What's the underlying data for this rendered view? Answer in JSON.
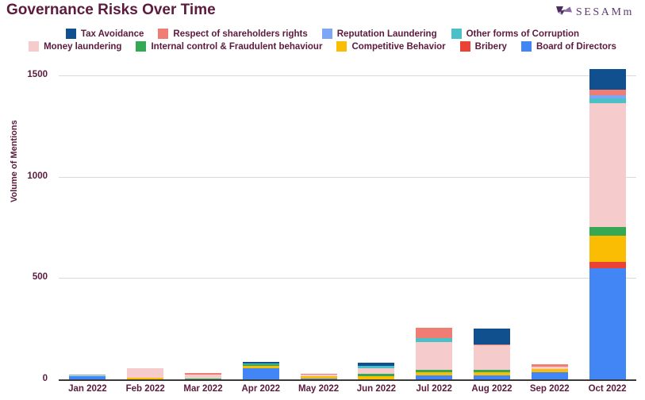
{
  "header": {
    "title": "Governance Risks Over Time",
    "logo_text": "SESAMm",
    "logo_mark_name": "sesamm-arrow-logo"
  },
  "chart_data": {
    "type": "bar",
    "stacked": true,
    "title": "Governance Risks Over Time",
    "xlabel": "",
    "ylabel": "Volume of Mentions",
    "ylim": [
      0,
      1500
    ],
    "yticks": [
      0,
      500,
      1000,
      1500
    ],
    "grid": true,
    "legend_position": "top",
    "categories": [
      "Jan 2022",
      "Feb 2022",
      "Mar 2022",
      "Apr 2022",
      "May 2022",
      "Jun 2022",
      "Jul 2022",
      "Aug 2022",
      "Sep 2022",
      "Oct 2022"
    ],
    "series": [
      {
        "name": "Board of Directors",
        "color": "#4285f4",
        "values": [
          14,
          0,
          0,
          56,
          3,
          0,
          20,
          20,
          36,
          550
        ]
      },
      {
        "name": "Bribery",
        "color": "#ea4335",
        "values": [
          0,
          0,
          0,
          0,
          0,
          0,
          0,
          0,
          0,
          28
        ]
      },
      {
        "name": "Competitive Behavior",
        "color": "#fbbc04",
        "values": [
          0,
          6,
          0,
          10,
          11,
          16,
          16,
          14,
          14,
          132
        ]
      },
      {
        "name": "Internal control & Fraudulent behaviour",
        "color": "#34a853",
        "values": [
          0,
          0,
          4,
          8,
          0,
          11,
          12,
          12,
          0,
          44
        ]
      },
      {
        "name": "Money laundering",
        "color": "#f5cbcb",
        "values": [
          4,
          48,
          20,
          0,
          10,
          28,
          137,
          122,
          14,
          610
        ]
      },
      {
        "name": "Other forms of Corruption",
        "color": "#4bc0c6",
        "values": [
          4,
          0,
          0,
          5,
          0,
          13,
          20,
          0,
          0,
          22
        ]
      },
      {
        "name": "Reputation Laundering",
        "color": "#7da6f7",
        "values": [
          0,
          0,
          0,
          0,
          0,
          0,
          0,
          0,
          0,
          18
        ]
      },
      {
        "name": "Respect of shareholders rights",
        "color": "#ef7d74",
        "values": [
          0,
          0,
          8,
          0,
          4,
          0,
          48,
          6,
          10,
          24
        ]
      },
      {
        "name": "Tax Avoidance",
        "color": "#11508f",
        "values": [
          0,
          0,
          0,
          7,
          0,
          14,
          0,
          78,
          0,
          105
        ]
      }
    ]
  },
  "legend": {
    "rows": [
      [
        {
          "label": "Tax Avoidance",
          "color": "#11508f"
        },
        {
          "label": "Respect of shareholders rights",
          "color": "#ef7d74"
        },
        {
          "label": "Reputation Laundering",
          "color": "#7da6f7"
        },
        {
          "label": "Other forms of Corruption",
          "color": "#4bc0c6"
        }
      ],
      [
        {
          "label": "Money laundering",
          "color": "#f5cbcb"
        },
        {
          "label": "Internal control & Fraudulent behaviour",
          "color": "#34a853"
        },
        {
          "label": "Competitive Behavior",
          "color": "#fbbc04"
        },
        {
          "label": "Bribery",
          "color": "#ea4335"
        },
        {
          "label": "Board of Directors",
          "color": "#4285f4"
        }
      ]
    ]
  }
}
